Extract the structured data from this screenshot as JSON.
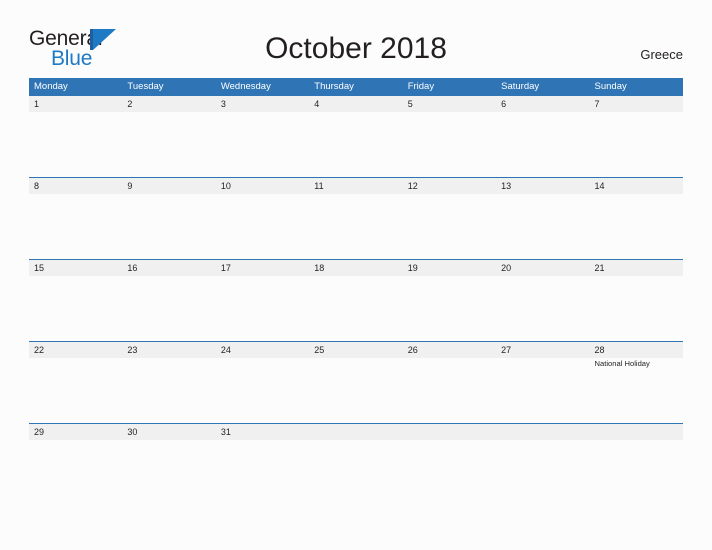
{
  "brand": {
    "name_part1": "General",
    "name_part2": "Blue",
    "flag_icon": "blue-flag-triangle-icon",
    "primary_color": "#1e7ac4",
    "header_color": "#2f74b5"
  },
  "header": {
    "title": "October 2018",
    "country": "Greece"
  },
  "calendar": {
    "weekdays": [
      "Monday",
      "Tuesday",
      "Wednesday",
      "Thursday",
      "Friday",
      "Saturday",
      "Sunday"
    ],
    "weeks": [
      {
        "days": [
          {
            "number": "1",
            "events": []
          },
          {
            "number": "2",
            "events": []
          },
          {
            "number": "3",
            "events": []
          },
          {
            "number": "4",
            "events": []
          },
          {
            "number": "5",
            "events": []
          },
          {
            "number": "6",
            "events": []
          },
          {
            "number": "7",
            "events": []
          }
        ]
      },
      {
        "days": [
          {
            "number": "8",
            "events": []
          },
          {
            "number": "9",
            "events": []
          },
          {
            "number": "10",
            "events": []
          },
          {
            "number": "11",
            "events": []
          },
          {
            "number": "12",
            "events": []
          },
          {
            "number": "13",
            "events": []
          },
          {
            "number": "14",
            "events": []
          }
        ]
      },
      {
        "days": [
          {
            "number": "15",
            "events": []
          },
          {
            "number": "16",
            "events": []
          },
          {
            "number": "17",
            "events": []
          },
          {
            "number": "18",
            "events": []
          },
          {
            "number": "19",
            "events": []
          },
          {
            "number": "20",
            "events": []
          },
          {
            "number": "21",
            "events": []
          }
        ]
      },
      {
        "days": [
          {
            "number": "22",
            "events": []
          },
          {
            "number": "23",
            "events": []
          },
          {
            "number": "24",
            "events": []
          },
          {
            "number": "25",
            "events": []
          },
          {
            "number": "26",
            "events": []
          },
          {
            "number": "27",
            "events": []
          },
          {
            "number": "28",
            "events": [
              "National Holiday"
            ]
          }
        ]
      },
      {
        "days": [
          {
            "number": "29",
            "events": []
          },
          {
            "number": "30",
            "events": []
          },
          {
            "number": "31",
            "events": []
          },
          {
            "number": "",
            "events": []
          },
          {
            "number": "",
            "events": []
          },
          {
            "number": "",
            "events": []
          },
          {
            "number": "",
            "events": []
          }
        ]
      }
    ]
  }
}
